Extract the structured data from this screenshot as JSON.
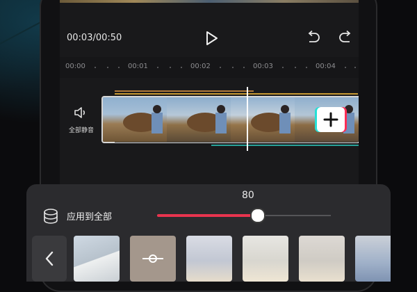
{
  "player": {
    "time_display": "00:03/00:50"
  },
  "ruler": {
    "ticks": [
      "00:00",
      "00:01",
      "00:02",
      "00:03",
      "00:04"
    ]
  },
  "track": {
    "mute_label": "全部静音"
  },
  "adjust_panel": {
    "slider_value": "80",
    "slider_level": 0.8,
    "apply_all_label": "应用到全部"
  },
  "colors": {
    "accent": "#e8344e",
    "tiktok_cyan": "#25e0d6",
    "tiktok_pink": "#fe2c55"
  },
  "icons": {
    "play": "play-icon",
    "undo": "undo-icon",
    "redo": "redo-icon",
    "mute": "speaker-icon",
    "add": "plus-icon",
    "apply_all": "layers-icon",
    "back": "chevron-left-icon"
  }
}
